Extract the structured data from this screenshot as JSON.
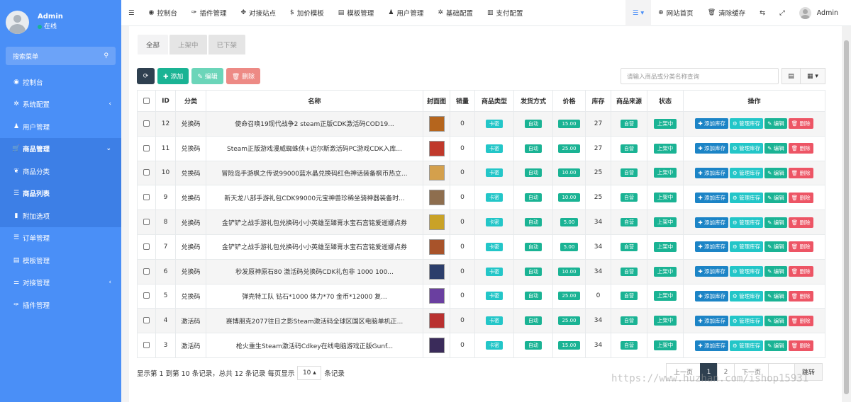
{
  "sidebar": {
    "user": {
      "name": "Admin",
      "status": "在线"
    },
    "search_label": "搜索菜单",
    "items": [
      {
        "label": "控制台",
        "icon": "dashboard-icon",
        "glyph": "◉"
      },
      {
        "label": "系统配置",
        "icon": "gear-icon",
        "glyph": "✲",
        "chevron": "‹"
      },
      {
        "label": "用户管理",
        "icon": "user-icon",
        "glyph": "♟"
      },
      {
        "label": "商品管理",
        "icon": "cart-icon",
        "glyph": "🛒",
        "chevron": "⌄"
      },
      {
        "label": "商品分类",
        "icon": "leaf-icon",
        "glyph": "❦"
      },
      {
        "label": "商品列表",
        "icon": "list-icon",
        "glyph": "☰"
      },
      {
        "label": "附加选项",
        "icon": "bookmark-icon",
        "glyph": "▮"
      },
      {
        "label": "订单管理",
        "icon": "list-icon",
        "glyph": "☰"
      },
      {
        "label": "模板管理",
        "icon": "template-icon",
        "glyph": "▤"
      },
      {
        "label": "对接管理",
        "icon": "sliders-icon",
        "glyph": "⚌",
        "chevron": "‹"
      },
      {
        "label": "插件管理",
        "icon": "wrench-icon",
        "glyph": "✑"
      }
    ]
  },
  "topnav": {
    "menu_glyph": "☰",
    "items": [
      {
        "label": "控制台",
        "glyph": "◉"
      },
      {
        "label": "插件管理",
        "glyph": "✑"
      },
      {
        "label": "对接站点",
        "glyph": "✥"
      },
      {
        "label": "加价模板",
        "glyph": "$"
      },
      {
        "label": "模板管理",
        "glyph": "▤"
      },
      {
        "label": "用户管理",
        "glyph": "♟"
      },
      {
        "label": "基础配置",
        "glyph": "✲"
      },
      {
        "label": "支付配置",
        "glyph": "▥"
      }
    ],
    "right": {
      "list_glyph": "☰ ▾",
      "site_home": "网站首页",
      "site_home_glyph": "⊕",
      "clear_cache": "清除缓存",
      "clear_cache_glyph": "🗑",
      "lang_glyph": "⇆",
      "fullscreen_glyph": "⤢",
      "user_name": "Admin"
    }
  },
  "tabs": [
    "全部",
    "上架中",
    "已下架"
  ],
  "toolbar": {
    "refresh_glyph": "⟳",
    "add": "✚ 添加",
    "edit": "✎ 编辑",
    "delete": "🗑 删除",
    "search_placeholder": "请输入商品或分类名称查询",
    "view_glyph": "▤",
    "columns_glyph": "▦ ▾"
  },
  "table": {
    "headers": [
      "ID",
      "分类",
      "名称",
      "封面图",
      "销量",
      "商品类型",
      "发货方式",
      "价格",
      "库存",
      "商品来源",
      "状态",
      "操作"
    ],
    "actions": {
      "add_stock": "✚ 添加库存",
      "manage_stock": "⚙ 管理库存",
      "edit": "✎ 编辑",
      "delete": "🗑 删除"
    },
    "rows": [
      {
        "id": "12",
        "cat": "兑换码",
        "name": "使命召唤19现代战争2 steam正版CDK激活码COD19...",
        "sales": "0",
        "type": "卡密",
        "ship": "自动",
        "price": "15.00",
        "stock": "27",
        "source": "自营",
        "status": "上架中",
        "cover": "#b5651d"
      },
      {
        "id": "11",
        "cat": "兑换码",
        "name": "Steam正版游戏漫威蜘蛛侠+迈尔斯激活码PC游戏CDK入库...",
        "sales": "0",
        "type": "卡密",
        "ship": "自动",
        "price": "25.00",
        "stock": "27",
        "source": "自营",
        "status": "上架中",
        "cover": "#c0392b"
      },
      {
        "id": "10",
        "cat": "兑换码",
        "name": "冒险岛手游枫之传说99000蓝水晶兑换码红色神话装备枫币热立...",
        "sales": "0",
        "type": "卡密",
        "ship": "自动",
        "price": "10.00",
        "stock": "25",
        "source": "自营",
        "status": "上架中",
        "cover": "#d4a04c"
      },
      {
        "id": "9",
        "cat": "兑换码",
        "name": "新天龙八部手游礼包CDK99000元宝神兽珍稀坐骑神器装备时...",
        "sales": "0",
        "type": "卡密",
        "ship": "自动",
        "price": "10.00",
        "stock": "25",
        "source": "自营",
        "status": "上架中",
        "cover": "#8e6e4e"
      },
      {
        "id": "8",
        "cat": "兑换码",
        "name": "金铲铲之战手游礼包兑换码小小英雄至臻膏水宝石宫铭爱逝娜点券",
        "sales": "0",
        "type": "卡密",
        "ship": "自动",
        "price": "5.00",
        "stock": "34",
        "source": "自营",
        "status": "上架中",
        "cover": "#c9a227"
      },
      {
        "id": "7",
        "cat": "兑换码",
        "name": "金铲铲之战手游礼包兑换码小小英雄至臻膏水宝石宫铭爱逝娜点券",
        "sales": "0",
        "type": "卡密",
        "ship": "自动",
        "price": "5.00",
        "stock": "34",
        "source": "自营",
        "status": "上架中",
        "cover": "#a8532a"
      },
      {
        "id": "6",
        "cat": "兑换码",
        "name": "秒发原神原石80 激活码兑换码CDK礼包非 1000 100...",
        "sales": "0",
        "type": "卡密",
        "ship": "自动",
        "price": "10.00",
        "stock": "34",
        "source": "自营",
        "status": "上架中",
        "cover": "#2c3e6b"
      },
      {
        "id": "5",
        "cat": "兑换码",
        "name": "弹壳特工队 钻石*1000 体力*70 金币*12000 复...",
        "sales": "0",
        "type": "卡密",
        "ship": "自动",
        "price": "25.00",
        "stock": "0",
        "source": "自营",
        "status": "上架中",
        "cover": "#6a3fa0"
      },
      {
        "id": "4",
        "cat": "激活码",
        "name": "赛博朋克2077往日之影Steam激活码全球区国区电脑单机正...",
        "sales": "0",
        "type": "卡密",
        "ship": "自动",
        "price": "25.00",
        "stock": "34",
        "source": "自营",
        "status": "上架中",
        "cover": "#b9302f"
      },
      {
        "id": "3",
        "cat": "激活码",
        "name": "枪火重生Steam激活码Cdkey在线电脑游戏正版Gunf...",
        "sales": "0",
        "type": "卡密",
        "ship": "自动",
        "price": "15.00",
        "stock": "34",
        "source": "自营",
        "status": "上架中",
        "cover": "#3a2b5a"
      }
    ]
  },
  "footer": {
    "info": "显示第 1 到第 10 条记录，总共 12 条记录 每页显示",
    "page_size": "10 ▴",
    "suffix": "条记录",
    "prev": "上一页",
    "page1": "1",
    "page2": "2",
    "next": "下一页",
    "jump": "跳转"
  },
  "watermark": "https://www.huzhan.com/ishop15931"
}
